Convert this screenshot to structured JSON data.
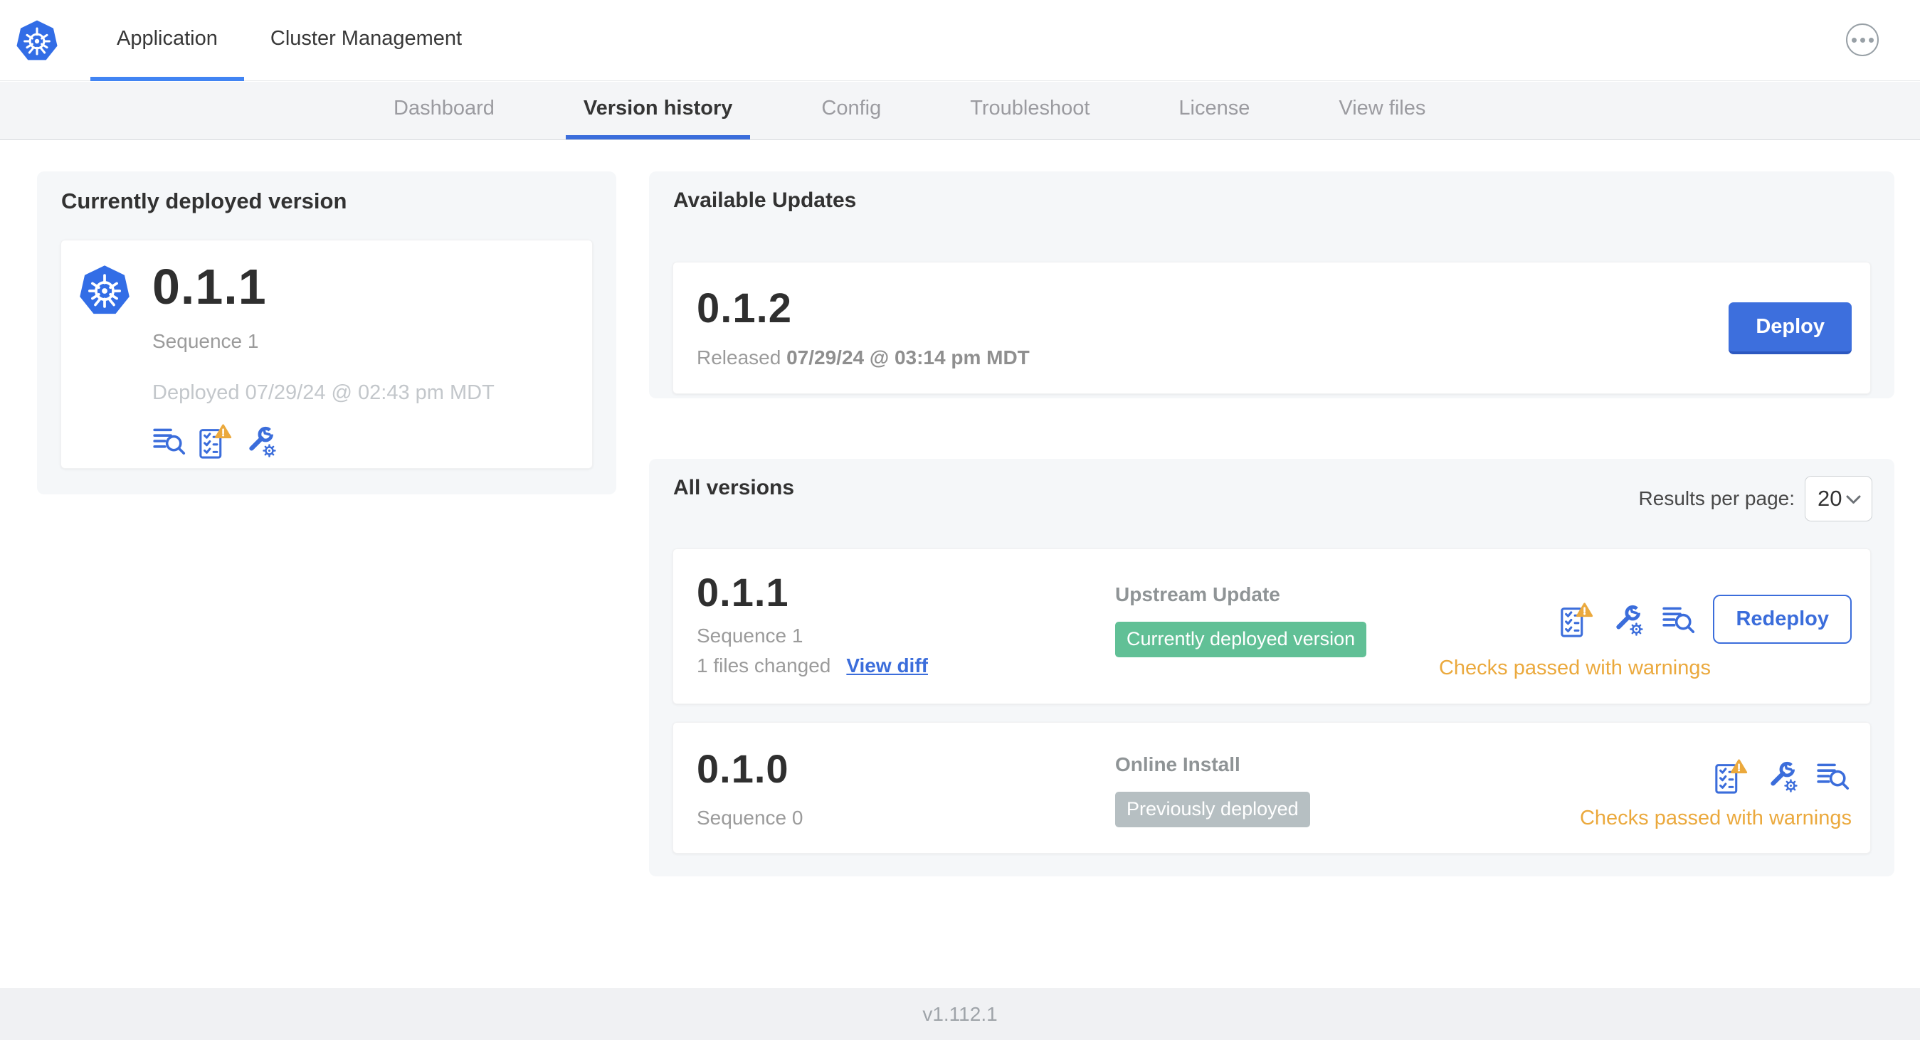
{
  "header": {
    "tabs": [
      {
        "label": "Application",
        "active": true
      },
      {
        "label": "Cluster Management",
        "active": false
      }
    ],
    "menu_icon": "ellipsis-circle"
  },
  "subnav": {
    "tabs": [
      {
        "label": "Dashboard",
        "active": false
      },
      {
        "label": "Version history",
        "active": true
      },
      {
        "label": "Config",
        "active": false
      },
      {
        "label": "Troubleshoot",
        "active": false
      },
      {
        "label": "License",
        "active": false
      },
      {
        "label": "View files",
        "active": false
      }
    ]
  },
  "current_version": {
    "title": "Currently deployed version",
    "version": "0.1.1",
    "sequence": "Sequence 1",
    "deployed": "Deployed 07/29/24 @ 02:43 pm MDT",
    "icons": [
      "deploy-logs-icon",
      "preflight-checks-warning-icon",
      "config-icon"
    ]
  },
  "available_updates": {
    "title": "Available Updates",
    "version": "0.1.2",
    "released_prefix": "Released ",
    "released_date": "07/29/24 @ 03:14 pm MDT",
    "deploy_label": "Deploy"
  },
  "all_versions": {
    "title": "All versions",
    "results_per_page_label": "Results per page:",
    "results_per_page_value": "20",
    "rows": [
      {
        "version": "0.1.1",
        "sequence": "Sequence 1",
        "files_changed": "1 files changed",
        "view_diff_label": "View diff",
        "source": "Upstream Update",
        "badge": "Currently deployed version",
        "badge_color": "green",
        "icons": [
          "preflight-checks-warning-icon",
          "config-icon",
          "deploy-logs-icon"
        ],
        "action_label": "Redeploy",
        "status": "Checks passed with warnings"
      },
      {
        "version": "0.1.0",
        "sequence": "Sequence 0",
        "source": "Online Install",
        "badge": "Previously deployed",
        "badge_color": "gray",
        "icons": [
          "preflight-checks-warning-icon",
          "config-icon",
          "deploy-logs-icon"
        ],
        "status": "Checks passed with warnings"
      }
    ]
  },
  "footer": {
    "app_version": "v1.112.1"
  },
  "colors": {
    "accent_blue": "#3b6ddb",
    "kubernetes_blue": "#326de6",
    "badge_green": "#61c096",
    "badge_gray": "#b6bfc2",
    "warning_orange": "#eba93d",
    "panel_gray": "#f5f7f9"
  }
}
